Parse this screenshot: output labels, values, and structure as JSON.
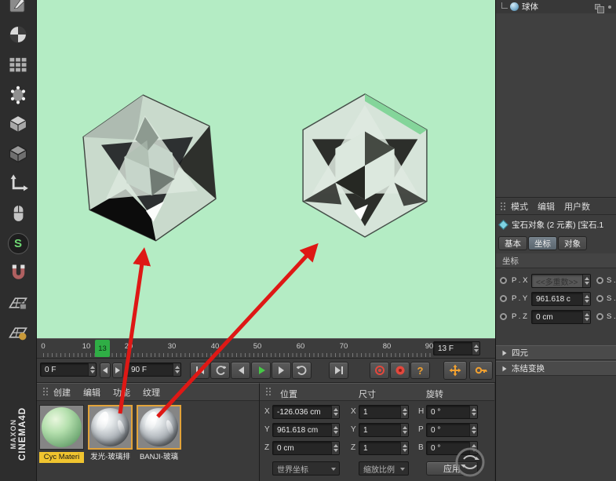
{
  "colors": {
    "viewport_bg": "#b4ecc4",
    "arrow_red": "#de1815",
    "accent_orange": "#f0a030",
    "play_green": "#46c846",
    "marker_green": "#2fae45",
    "label_highlight": "#f0c42f"
  },
  "brand": {
    "maxon": "MAXON",
    "cinema": "CINEMA4D"
  },
  "left_toolbar": {
    "s_badge": "S"
  },
  "object_manager": {
    "item": "球体"
  },
  "attributes": {
    "menu": [
      "模式",
      "编辑",
      "用户数"
    ],
    "title": "宝石对象 (2 元素) [宝石.1",
    "tabs": [
      "基本",
      "坐标",
      "对象"
    ],
    "active_tab": "坐标",
    "section": "坐标",
    "rows": [
      {
        "label": "P . X",
        "value": "<<多重数>>",
        "right": "S ."
      },
      {
        "label": "P . Y",
        "value": "961.618 c",
        "right": "S ."
      },
      {
        "label": "P . Z",
        "value": "0 cm",
        "right": "S ."
      }
    ],
    "groups": [
      "四元",
      "冻结变换"
    ]
  },
  "timeline": {
    "ticks": [
      "0",
      "10",
      "20",
      "30",
      "40",
      "50",
      "60",
      "70",
      "80",
      "90"
    ],
    "marker": "13",
    "frame_field": "13 F"
  },
  "transport": {
    "range_start": "0 F",
    "range_end": "90 F",
    "help_label": "?"
  },
  "materials": {
    "menu": [
      "创建",
      "编辑",
      "功能",
      "纹理"
    ],
    "items": [
      {
        "name": "Cyc Materi"
      },
      {
        "name": "发光-玻璃排"
      },
      {
        "name": "BANJI-玻璃"
      }
    ]
  },
  "coord_manager": {
    "headers": [
      "位置",
      "尺寸",
      "旋转"
    ],
    "position": {
      "rows": [
        {
          "axis": "X",
          "value": "-126.036 cm"
        },
        {
          "axis": "Y",
          "value": "961.618 cm"
        },
        {
          "axis": "Z",
          "value": "0 cm"
        }
      ]
    },
    "size": {
      "rows": [
        {
          "axis": "X",
          "value": "1"
        },
        {
          "axis": "Y",
          "value": "1"
        },
        {
          "axis": "Z",
          "value": "1"
        }
      ]
    },
    "rotation": {
      "rows": [
        {
          "axis": "H",
          "value": "0 °"
        },
        {
          "axis": "P",
          "value": "0 °"
        },
        {
          "axis": "B",
          "value": "0 °"
        }
      ]
    },
    "space": "世界坐标",
    "scale_mode": "缩放比例",
    "apply": "应用"
  }
}
